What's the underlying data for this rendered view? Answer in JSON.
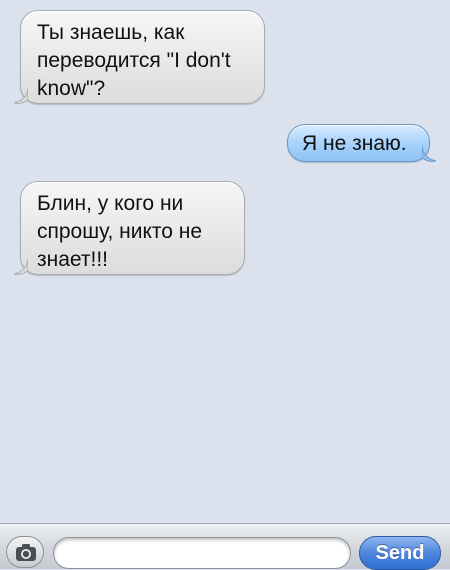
{
  "conversation": {
    "messages": [
      {
        "direction": "incoming",
        "text": "Ты знаешь, как переводится \"I don't know\"?"
      },
      {
        "direction": "outgoing",
        "text": "Я не знаю."
      },
      {
        "direction": "incoming",
        "text": "Блин, у кого ни спрошу, никто не знает!!!"
      }
    ]
  },
  "composer": {
    "camera_icon": "camera-icon",
    "input_value": "",
    "input_placeholder": "",
    "send_label": "Send"
  },
  "colors": {
    "background": "#dbe2ed",
    "incoming_bubble": "#e8e8e8",
    "outgoing_bubble": "#a9d3fb",
    "send_button": "#4e86dd"
  }
}
